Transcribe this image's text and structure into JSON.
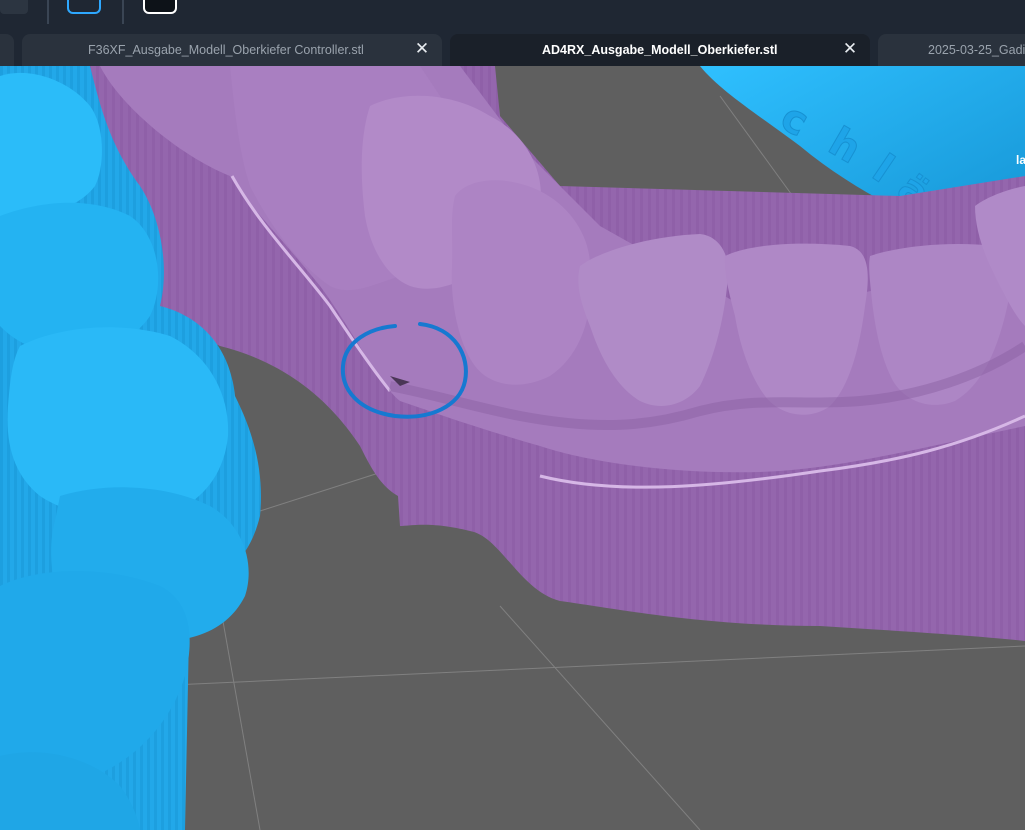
{
  "toolbar": {
    "left_button": "button",
    "slice_icon": "layers-icon",
    "export_icon": "export-icon"
  },
  "tabs": [
    {
      "label": "F36XF_Ausgabe_Modell_Oberkiefer Controller.stl",
      "active": false
    },
    {
      "label": "AD4RX_Ausgabe_Modell_Oberkiefer.stl",
      "active": true
    },
    {
      "label": "2025-03-25_Gadi",
      "active": false
    }
  ],
  "viewport": {
    "corner_text": "la",
    "engraving": "chlän"
  },
  "colors": {
    "model_purple": "#a67bbd",
    "model_blue": "#23b1ef",
    "annotation_blue": "#1679d1",
    "floor": "#5f5f5f"
  }
}
